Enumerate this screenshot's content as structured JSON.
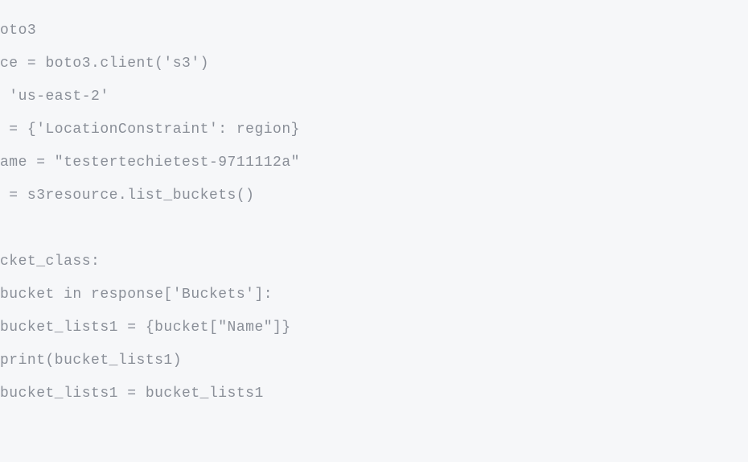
{
  "code": {
    "lines": [
      "oto3",
      "ce = boto3.client('s3')",
      " 'us-east-2'",
      " = {'LocationConstraint': region}",
      "ame = \"testertechietest-9711112a\"",
      " = s3resource.list_buckets()",
      "",
      "cket_class:",
      "bucket in response['Buckets']:",
      "bucket_lists1 = {bucket[\"Name\"]}",
      "print(bucket_lists1)",
      "bucket_lists1 = bucket_lists1"
    ]
  }
}
